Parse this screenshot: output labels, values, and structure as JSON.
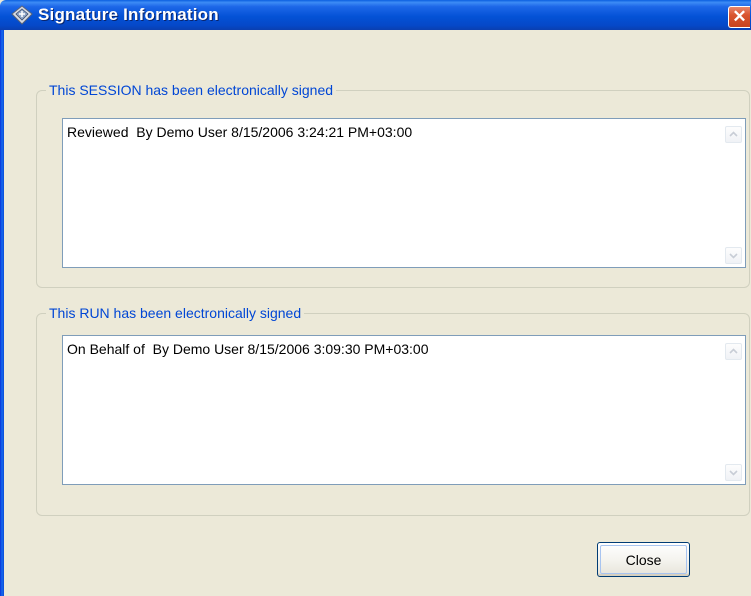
{
  "window": {
    "title": "Signature Information",
    "close_glyph": "✕",
    "app_icon": "shield-diamond-icon",
    "colors": {
      "titlebar": "#0452D6",
      "face": "#ECE9D8",
      "legend": "#0046D5",
      "close": "#D9552F"
    }
  },
  "session_group": {
    "legend": "This SESSION has been electronically signed",
    "text": "Reviewed  By Demo User 8/15/2006 3:24:21 PM+03:00"
  },
  "run_group": {
    "legend": "This RUN has been electronically signed",
    "text": "On Behalf of  By Demo User 8/15/2006 3:09:30 PM+03:00"
  },
  "footer": {
    "close_label": "Close"
  }
}
